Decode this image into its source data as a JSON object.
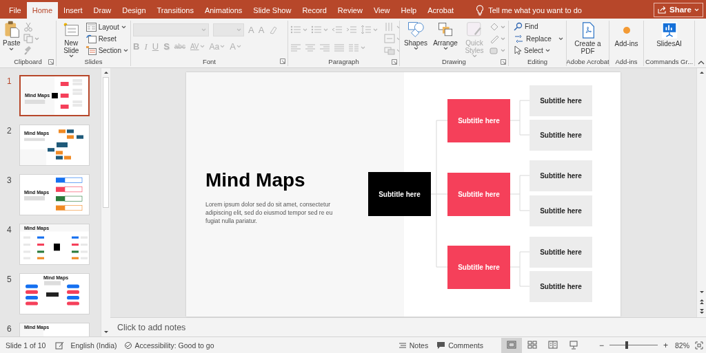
{
  "tabs": [
    {
      "label": "File",
      "selected": false
    },
    {
      "label": "Home",
      "selected": true
    },
    {
      "label": "Insert",
      "selected": false
    },
    {
      "label": "Draw",
      "selected": false
    },
    {
      "label": "Design",
      "selected": false
    },
    {
      "label": "Transitions",
      "selected": false
    },
    {
      "label": "Animations",
      "selected": false
    },
    {
      "label": "Slide Show",
      "selected": false
    },
    {
      "label": "Record",
      "selected": false
    },
    {
      "label": "Review",
      "selected": false
    },
    {
      "label": "View",
      "selected": false
    },
    {
      "label": "Help",
      "selected": false
    },
    {
      "label": "Acrobat",
      "selected": false
    }
  ],
  "tell_me": {
    "placeholder": "Tell me what you want to do"
  },
  "share": {
    "label": "Share"
  },
  "ribbon": {
    "groups": [
      {
        "kind": "clipboard",
        "label": "Clipboard",
        "launcher": true,
        "buttons": [
          {
            "label": "Paste"
          }
        ]
      },
      {
        "kind": "slides",
        "label": "Slides",
        "launcher": false,
        "buttons": [
          {
            "label": "New Slide"
          },
          {
            "label": "Layout"
          },
          {
            "label": "Reset"
          },
          {
            "label": "Section"
          }
        ]
      },
      {
        "kind": "font",
        "label": "Font",
        "launcher": true,
        "disabled": true,
        "size_buttons": [
          "A",
          "A"
        ],
        "format_buttons": [
          "B",
          "I",
          "U",
          "S",
          "abc",
          "AV",
          "Aa",
          "A"
        ]
      },
      {
        "kind": "paragraph",
        "label": "Paragraph",
        "launcher": true,
        "disabled": true
      },
      {
        "kind": "drawing",
        "label": "Drawing",
        "launcher": true,
        "buttons": [
          {
            "label": "Shapes",
            "disabled": false
          },
          {
            "label": "Arrange",
            "disabled": false
          },
          {
            "label": "Quick Styles",
            "disabled": true
          }
        ]
      },
      {
        "kind": "editing",
        "label": "Editing",
        "launcher": false,
        "buttons": [
          {
            "label": "Find"
          },
          {
            "label": "Replace"
          },
          {
            "label": "Select"
          }
        ]
      },
      {
        "kind": "single",
        "label": "Adobe Acrobat",
        "launcher": false,
        "buttons": [
          {
            "label": "Create a PDF"
          }
        ]
      },
      {
        "kind": "single",
        "label": "Add-ins",
        "launcher": false,
        "buttons": [
          {
            "label": "Add-ins"
          }
        ]
      },
      {
        "kind": "single",
        "label": "Commands Gr...",
        "launcher": false,
        "buttons": [
          {
            "label": "SlidesAI"
          }
        ]
      }
    ]
  },
  "thumbnails": [
    {
      "number": "1",
      "title": "Mind Maps",
      "selected": true,
      "kind": "tree"
    },
    {
      "number": "2",
      "title": "Mind Maps",
      "selected": false,
      "kind": "network"
    },
    {
      "number": "3",
      "title": "Mind Maps",
      "selected": false,
      "kind": "bars"
    },
    {
      "number": "4",
      "title": "Mind Maps",
      "selected": false,
      "kind": "sides"
    },
    {
      "number": "5",
      "title": "Mind Maps",
      "selected": false,
      "kind": "pills"
    },
    {
      "number": "6",
      "title": "Mind Maps",
      "selected": false,
      "kind": "plain"
    }
  ],
  "slide": {
    "title": "Mind Maps",
    "body": "Lorem ipsum dolor sed do sit amet, consectetur adipiscing elit, sed do eiusmod tempor sed re eu fugiat nulla pariatur.",
    "center": "Subtitle here",
    "branches": [
      {
        "label": "Subtitle here",
        "leaves": [
          "Subtitle here",
          "Subtitle here"
        ]
      },
      {
        "label": "Subtitle here",
        "leaves": [
          "Subtitle here",
          "Subtitle here"
        ]
      },
      {
        "label": "Subtitle here",
        "leaves": [
          "Subtitle here",
          "Subtitle here"
        ]
      }
    ]
  },
  "notes": {
    "placeholder": "Click to add notes"
  },
  "status_bar": {
    "slide": "Slide 1 of 10",
    "language": "English (India)",
    "accessibility": "Accessibility: Good to go",
    "notes": "Notes",
    "comments": "Comments",
    "views": [
      {
        "selected": true
      },
      {
        "selected": false
      },
      {
        "selected": false
      },
      {
        "selected": false
      }
    ],
    "zoom_out": "−",
    "zoom_in": "+",
    "zoom": {
      "level": 0.36
    },
    "zoom_reading": "82%"
  }
}
